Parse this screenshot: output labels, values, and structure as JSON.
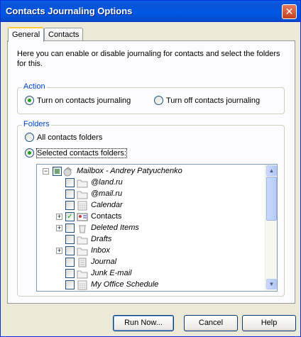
{
  "window": {
    "title": "Contacts Journaling Options",
    "close_glyph": "✕"
  },
  "tabs": [
    {
      "label": "General",
      "active": true
    },
    {
      "label": "Contacts",
      "active": false
    }
  ],
  "intro_text": "Here you can enable or disable journaling for contacts and select the folders for this.",
  "action_group": {
    "label": "Action",
    "options": [
      {
        "label": "Turn on contacts journaling",
        "checked": true
      },
      {
        "label": "Turn off contacts journaling",
        "checked": false
      }
    ]
  },
  "folders_group": {
    "label": "Folders",
    "options": [
      {
        "label": "All contacts folders",
        "checked": false
      },
      {
        "label": "Selected contacts folders:",
        "checked": true
      }
    ]
  },
  "tree": {
    "items": [
      {
        "label": "Mailbox - Andrey Patyuchenko",
        "checked": "partial",
        "expanded": true,
        "icon": "mailbox-icon"
      },
      {
        "label": "@land.ru",
        "checked": false,
        "icon": "folder-icon"
      },
      {
        "label": "@mail.ru",
        "checked": false,
        "icon": "folder-icon"
      },
      {
        "label": "Calendar",
        "checked": false,
        "icon": "calendar-icon"
      },
      {
        "label": "Contacts",
        "checked": true,
        "expandable": true,
        "icon": "contacts-icon"
      },
      {
        "label": "Deleted Items",
        "checked": false,
        "expandable": true,
        "icon": "deleted-items-icon"
      },
      {
        "label": "Drafts",
        "checked": false,
        "icon": "drafts-icon"
      },
      {
        "label": "Inbox",
        "checked": false,
        "expandable": true,
        "icon": "inbox-icon"
      },
      {
        "label": "Journal",
        "checked": false,
        "icon": "journal-icon"
      },
      {
        "label": "Junk E-mail",
        "checked": false,
        "icon": "junk-icon"
      },
      {
        "label": "My Office Schedule",
        "checked": false,
        "icon": "calendar-icon"
      }
    ]
  },
  "buttons": {
    "run_now": "Run Now...",
    "cancel": "Cancel",
    "help": "Help"
  }
}
